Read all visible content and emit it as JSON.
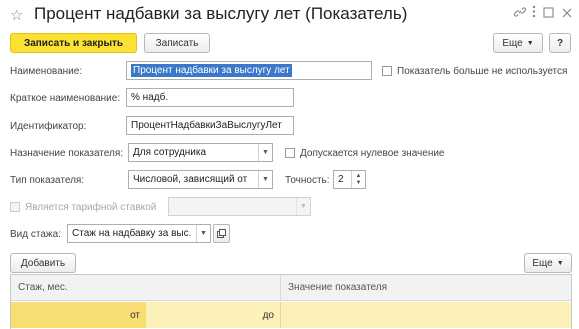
{
  "header": {
    "title": "Процент надбавки за выслугу лет (Показатель)"
  },
  "toolbar": {
    "save_close_label": "Записать и закрыть",
    "save_label": "Записать",
    "more_label": "Еще",
    "help_label": "?"
  },
  "form": {
    "name_label": "Наименование:",
    "name_value": "Процент надбавки за выслугу лет",
    "not_used_label": "Показатель больше не используется",
    "short_name_label": "Краткое наименование:",
    "short_name_value": "% надб.",
    "identifier_label": "Идентификатор:",
    "identifier_value": "ПроцентНадбавкиЗаВыслугуЛет",
    "purpose_label": "Назначение показателя:",
    "purpose_value": "Для сотрудника",
    "zero_allowed_label": "Допускается нулевое значение",
    "type_label": "Тип показателя:",
    "type_value": "Числовой, зависящий от",
    "precision_label": "Точность:",
    "precision_value": "2",
    "tariff_label": "Является тарифной ставкой",
    "tariff_value": "",
    "experience_label": "Вид стажа:",
    "experience_value": "Стаж на надбавку за выс."
  },
  "table": {
    "add_label": "Добавить",
    "more_label": "Еще",
    "col_experience": "Стаж, мес.",
    "col_value": "Значение показателя",
    "row_from": "от",
    "row_to": "до"
  },
  "icons": {
    "favorite": "star-icon",
    "link": "link-icon",
    "menu": "kebab-icon",
    "maximize": "maximize-icon",
    "close": "close-icon",
    "open": "open-icon"
  },
  "colors": {
    "primary_button": "#fbe232",
    "selection": "#3a78c9",
    "row_highlight": "#fcf1b8"
  }
}
